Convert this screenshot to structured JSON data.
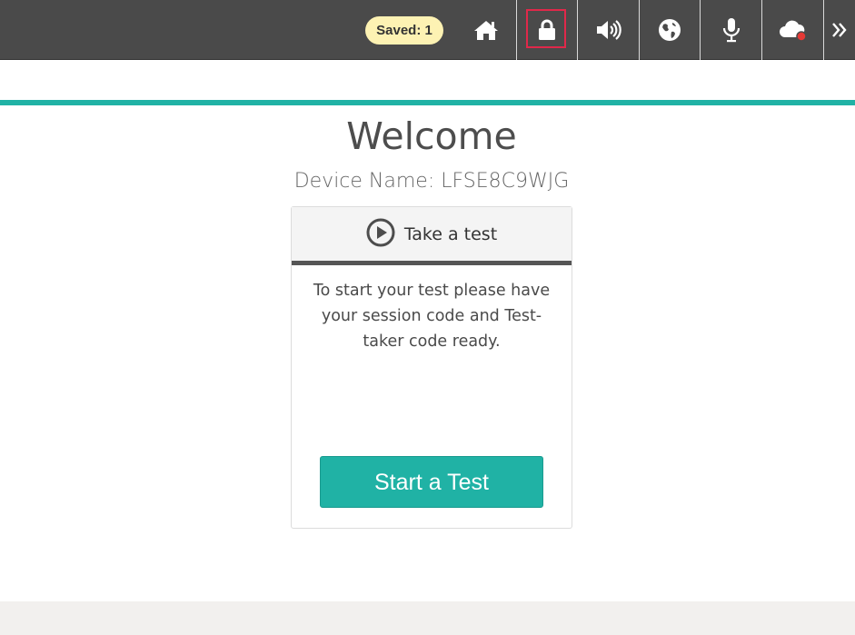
{
  "toolbar": {
    "saved_label": "Saved: 1",
    "buttons": [
      {
        "name": "home",
        "icon": "home-icon"
      },
      {
        "name": "lock",
        "icon": "lock-icon",
        "highlighted": true
      },
      {
        "name": "audio",
        "icon": "speaker-icon"
      },
      {
        "name": "language",
        "icon": "globe-icon"
      },
      {
        "name": "microphone",
        "icon": "microphone-icon"
      },
      {
        "name": "connection",
        "icon": "cloud-status-icon",
        "status_color": "#e53935"
      },
      {
        "name": "more",
        "icon": "double-chevron-right-icon"
      }
    ],
    "colors": {
      "bar": "#4a4a4a",
      "badge": "#fdf2b3",
      "highlight": "#e0284a"
    }
  },
  "page": {
    "title": "Welcome",
    "device_name": "Device Name: LFSE8C9WJG",
    "accent_color": "#20b2a5"
  },
  "card": {
    "title": "Take a test",
    "icon": "play-circle-icon",
    "body": "To start your test please have your session code and Test-taker code ready.",
    "button_label": "Start a Test"
  }
}
